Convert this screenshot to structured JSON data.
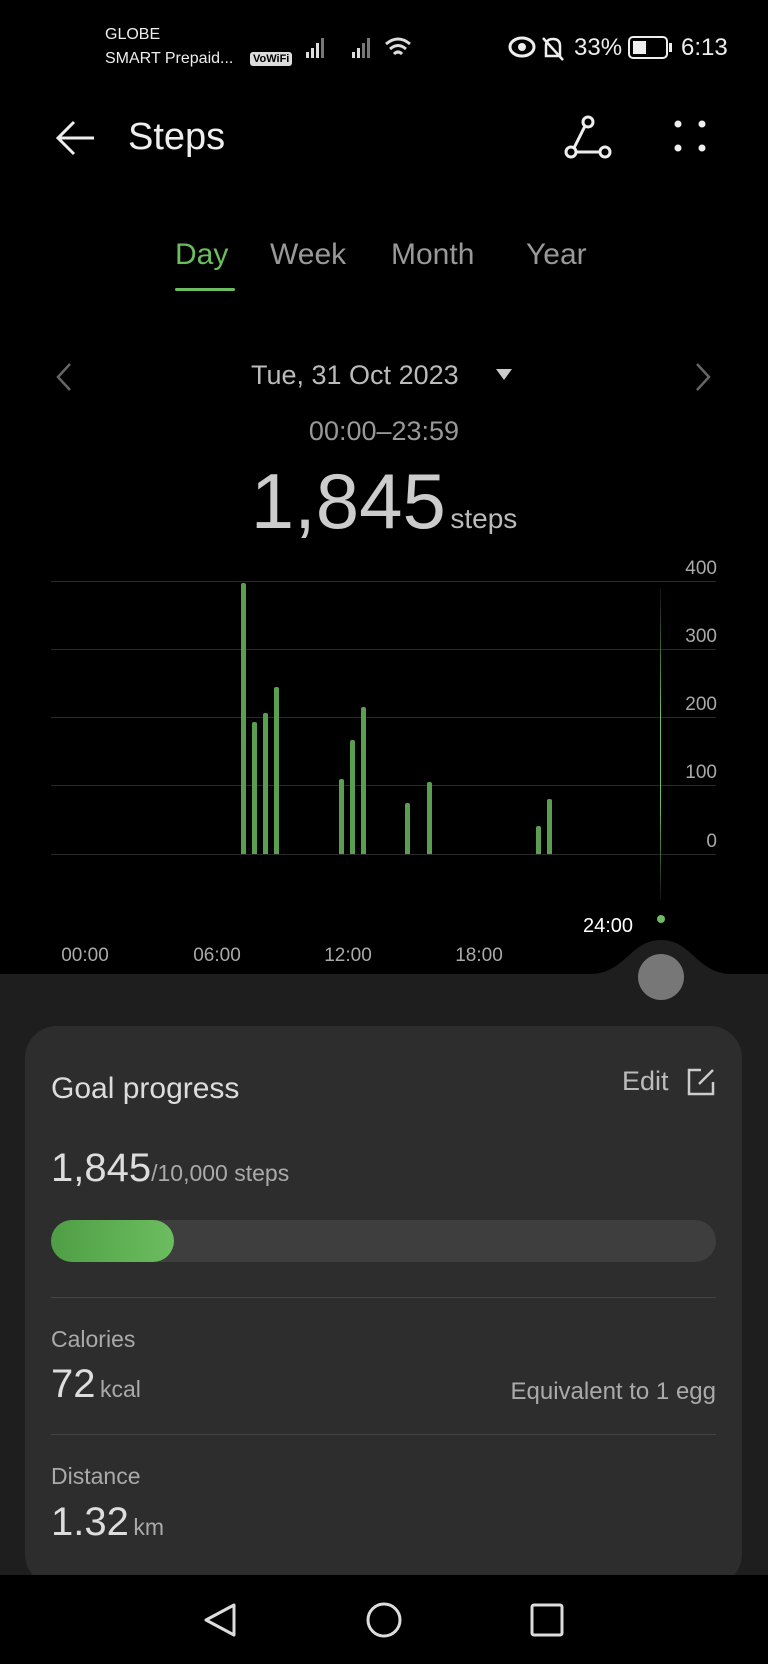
{
  "status_bar": {
    "carrier1": "GLOBE",
    "carrier2": "SMART Prepaid...",
    "vowifi": "VoWiFi",
    "battery": "33%",
    "time": "6:13"
  },
  "header": {
    "title": "Steps"
  },
  "tabs": [
    {
      "label": "Day",
      "active": true
    },
    {
      "label": "Week"
    },
    {
      "label": "Month"
    },
    {
      "label": "Year"
    }
  ],
  "date": {
    "label": "Tue, 31 Oct 2023",
    "range": "00:00–23:59"
  },
  "total": {
    "value": "1,845",
    "unit": "steps"
  },
  "accent": "#6cbd5f",
  "chart_data": {
    "type": "bar",
    "x_unit": "hour",
    "x": [
      "07:00",
      "07:30",
      "08:00",
      "08:30",
      "11:30",
      "12:00",
      "12:30",
      "14:30",
      "15:30",
      "20:30",
      "21:00"
    ],
    "values": [
      397,
      193,
      206,
      244,
      110,
      167,
      215,
      74,
      106,
      41,
      81
    ],
    "ylim": [
      0,
      400
    ],
    "y_ticks": [
      "400",
      "300",
      "200",
      "100",
      "0"
    ],
    "x_ticks": [
      "00:00",
      "06:00",
      "12:00",
      "18:00"
    ],
    "cursor_label": "24:00",
    "grid": true,
    "y_axis": "right"
  },
  "goal": {
    "title": "Goal progress",
    "edit": "Edit",
    "current": "1,845",
    "target": "/10,000 steps",
    "progress": 0.1845
  },
  "calories": {
    "label": "Calories",
    "value": "72",
    "unit": "kcal",
    "equivalent": "Equivalent to 1 egg"
  },
  "distance": {
    "label": "Distance",
    "value": "1.32",
    "unit": "km"
  }
}
